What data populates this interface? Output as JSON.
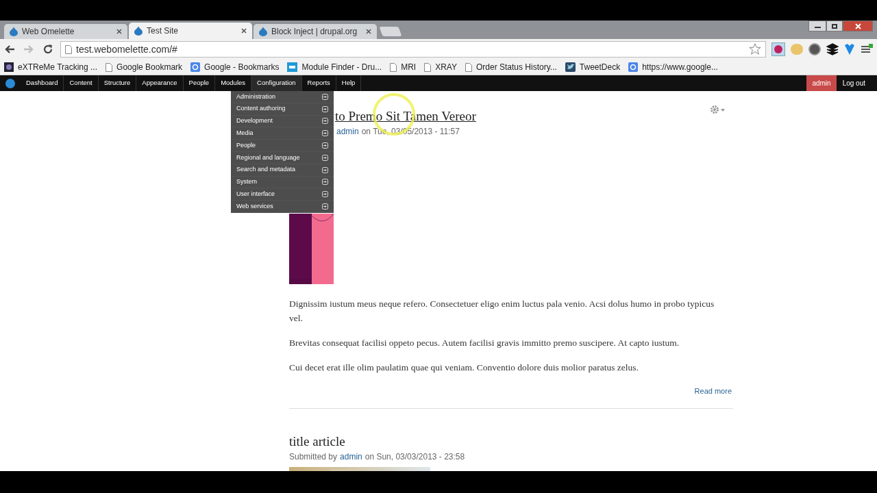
{
  "browser": {
    "tabs": [
      {
        "title": "Web Omelette",
        "selected": false
      },
      {
        "title": "Test Site",
        "selected": true
      },
      {
        "title": "Block Inject | drupal.org",
        "selected": false
      }
    ],
    "url": "test.webomelette.com/#",
    "bookmarks": [
      {
        "label": "eXTReMe Tracking ...",
        "kind": "tracker"
      },
      {
        "label": "Google Bookmark",
        "kind": "page"
      },
      {
        "label": "Google - Bookmarks",
        "kind": "g"
      },
      {
        "label": "Module Finder - Dru...",
        "kind": "dm"
      },
      {
        "label": "MRI",
        "kind": "page"
      },
      {
        "label": "XRAY",
        "kind": "page"
      },
      {
        "label": "Order Status History...",
        "kind": "page"
      },
      {
        "label": "TweetDeck",
        "kind": "bird"
      },
      {
        "label": "https://www.google...",
        "kind": "g"
      }
    ]
  },
  "toolbar": {
    "items": [
      {
        "label": "Dashboard",
        "expanded": false
      },
      {
        "label": "Content",
        "expanded": false
      },
      {
        "label": "Structure",
        "expanded": false
      },
      {
        "label": "Appearance",
        "expanded": false
      },
      {
        "label": "People",
        "expanded": false
      },
      {
        "label": "Modules",
        "expanded": false
      },
      {
        "label": "Configuration",
        "expanded": true
      },
      {
        "label": "Reports",
        "expanded": false
      },
      {
        "label": "Help",
        "expanded": false
      }
    ],
    "user": "admin",
    "logout": "Log out",
    "dropdown": [
      "Administration",
      "Content authoring",
      "Development",
      "Media",
      "People",
      "Regional and language",
      "Search and metadata",
      "System",
      "User interface",
      "Web services"
    ]
  },
  "articles": [
    {
      "title": "to Premo Sit Tamen Vereor",
      "author": "admin",
      "date": "on Tue, 03/05/2013 - 11:57",
      "paragraphs": [
        "Dignissim iustum meus neque refero. Consectetuer eligo enim luctus pala venio. Acsi dolus humo in probo typicus vel.",
        "Brevitas consequat facilisi oppeto pecus. Autem facilisi gravis immitto premo suscipere. At capto iustum.",
        "Cui decet erat ille olim paulatim quae qui veniam. Conventio dolore duis molior paratus zelus."
      ],
      "read_more": "Read more"
    },
    {
      "title": "title article",
      "submitted": "Submitted by",
      "author": "admin",
      "date": "on Sun, 03/03/2013 - 23:58"
    }
  ]
}
